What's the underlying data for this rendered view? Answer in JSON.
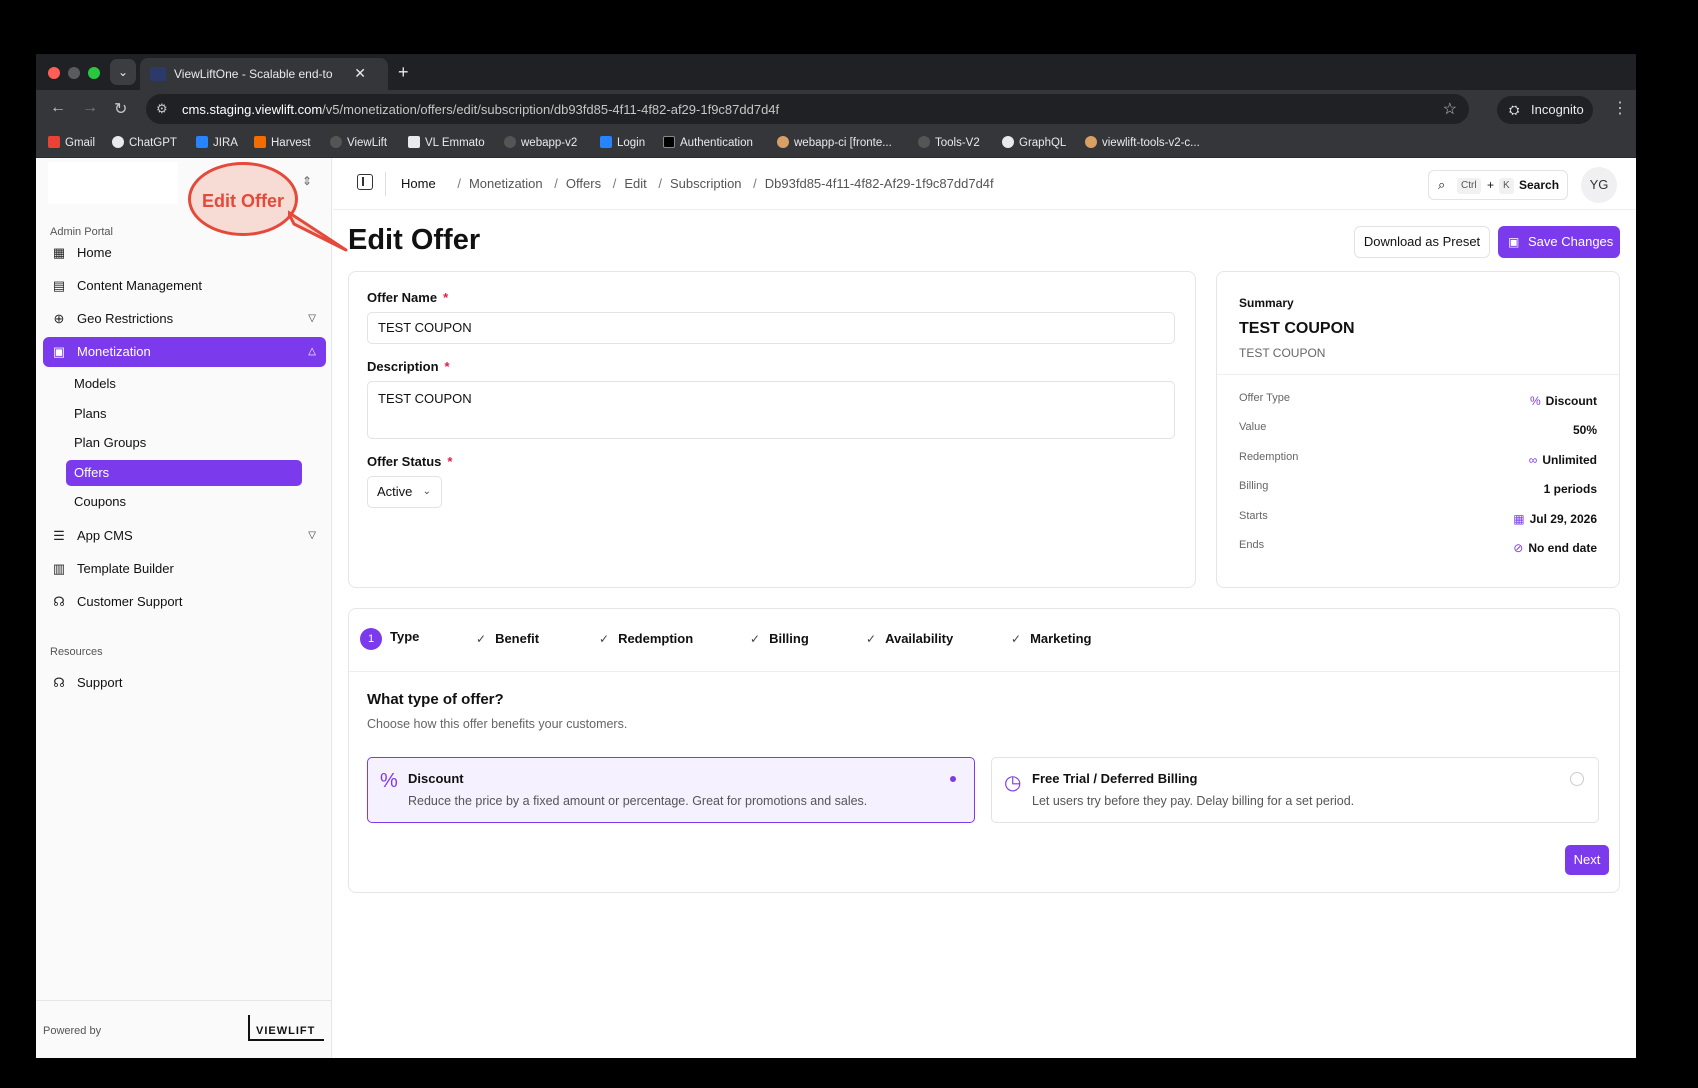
{
  "browser": {
    "tab_title": "ViewLiftOne - Scalable end-to",
    "url_host": "cms.staging.viewlift.com",
    "url_path": "/v5/monetization/offers/edit/subscription/db93fd85-4f11-4f82-af29-1f9c87dd7d4f",
    "incognito_label": "Incognito",
    "bookmarks": [
      "Gmail",
      "ChatGPT",
      "JIRA",
      "Harvest",
      "ViewLift",
      "VL Emmato",
      "webapp-v2",
      "Login",
      "Authentication",
      "webapp-ci [fronte...",
      "Tools-V2",
      "GraphQL",
      "viewlift-tools-v2-c..."
    ]
  },
  "sidebar": {
    "section_admin": "Admin Portal",
    "items": [
      {
        "label": "Home",
        "icon": "grid-icon"
      },
      {
        "label": "Content Management",
        "icon": "film-icon"
      },
      {
        "label": "Geo Restrictions",
        "icon": "globe-icon"
      },
      {
        "label": "Monetization",
        "icon": "wallet-icon"
      },
      {
        "label": "App CMS",
        "icon": "sliders-icon"
      },
      {
        "label": "Template Builder",
        "icon": "layout-icon"
      },
      {
        "label": "Customer Support",
        "icon": "headset-icon"
      }
    ],
    "sub_items": [
      "Models",
      "Plans",
      "Plan Groups",
      "Offers",
      "Coupons"
    ],
    "section_resources": "Resources",
    "support_label": "Support",
    "powered_by": "Powered by",
    "brand": "VIEWLIFT"
  },
  "header": {
    "breadcrumbs": [
      "Home",
      "Monetization",
      "Offers",
      "Edit",
      "Subscription",
      "Db93fd85-4f11-4f82-Af29-1f9c87dd7d4f"
    ],
    "search_key1": "Ctrl",
    "search_plus": "+",
    "search_key2": "K",
    "search_label": "Search",
    "avatar_initials": "YG"
  },
  "callout": "Edit Offer",
  "page": {
    "title": "Edit Offer",
    "download_label": "Download as Preset",
    "save_label": "Save Changes"
  },
  "form": {
    "name_label": "Offer Name",
    "name_value": "TEST COUPON",
    "desc_label": "Description",
    "desc_value": "TEST COUPON",
    "status_label": "Offer Status",
    "status_value": "Active",
    "required_mark": "*"
  },
  "summary": {
    "label": "Summary",
    "name": "TEST COUPON",
    "description": "TEST COUPON",
    "rows": [
      {
        "key": "Offer Type",
        "value": "Discount",
        "icon": "%"
      },
      {
        "key": "Value",
        "value": "50%",
        "icon": ""
      },
      {
        "key": "Redemption",
        "value": "Unlimited",
        "icon": "∞"
      },
      {
        "key": "Billing",
        "value": "1 periods",
        "icon": ""
      },
      {
        "key": "Starts",
        "value": "Jul 29, 2026",
        "icon": "▦"
      },
      {
        "key": "Ends",
        "value": "No end date",
        "icon": "⊘"
      }
    ]
  },
  "wizard": {
    "steps": [
      {
        "label": "Type",
        "number": "1"
      },
      {
        "label": "Benefit"
      },
      {
        "label": "Redemption"
      },
      {
        "label": "Billing"
      },
      {
        "label": "Availability"
      },
      {
        "label": "Marketing"
      }
    ],
    "question": "What type of offer?",
    "question_sub": "Choose how this offer benefits your customers.",
    "options": [
      {
        "title": "Discount",
        "desc": "Reduce the price by a fixed amount or percentage. Great for promotions and sales.",
        "icon": "%",
        "selected": true
      },
      {
        "title": "Free Trial / Deferred Billing",
        "desc": "Let users try before they pay. Delay billing for a set period.",
        "icon": "◷",
        "selected": false
      }
    ],
    "next_label": "Next"
  },
  "colors": {
    "accent": "#7c3aed",
    "callout": "#e4493a"
  }
}
